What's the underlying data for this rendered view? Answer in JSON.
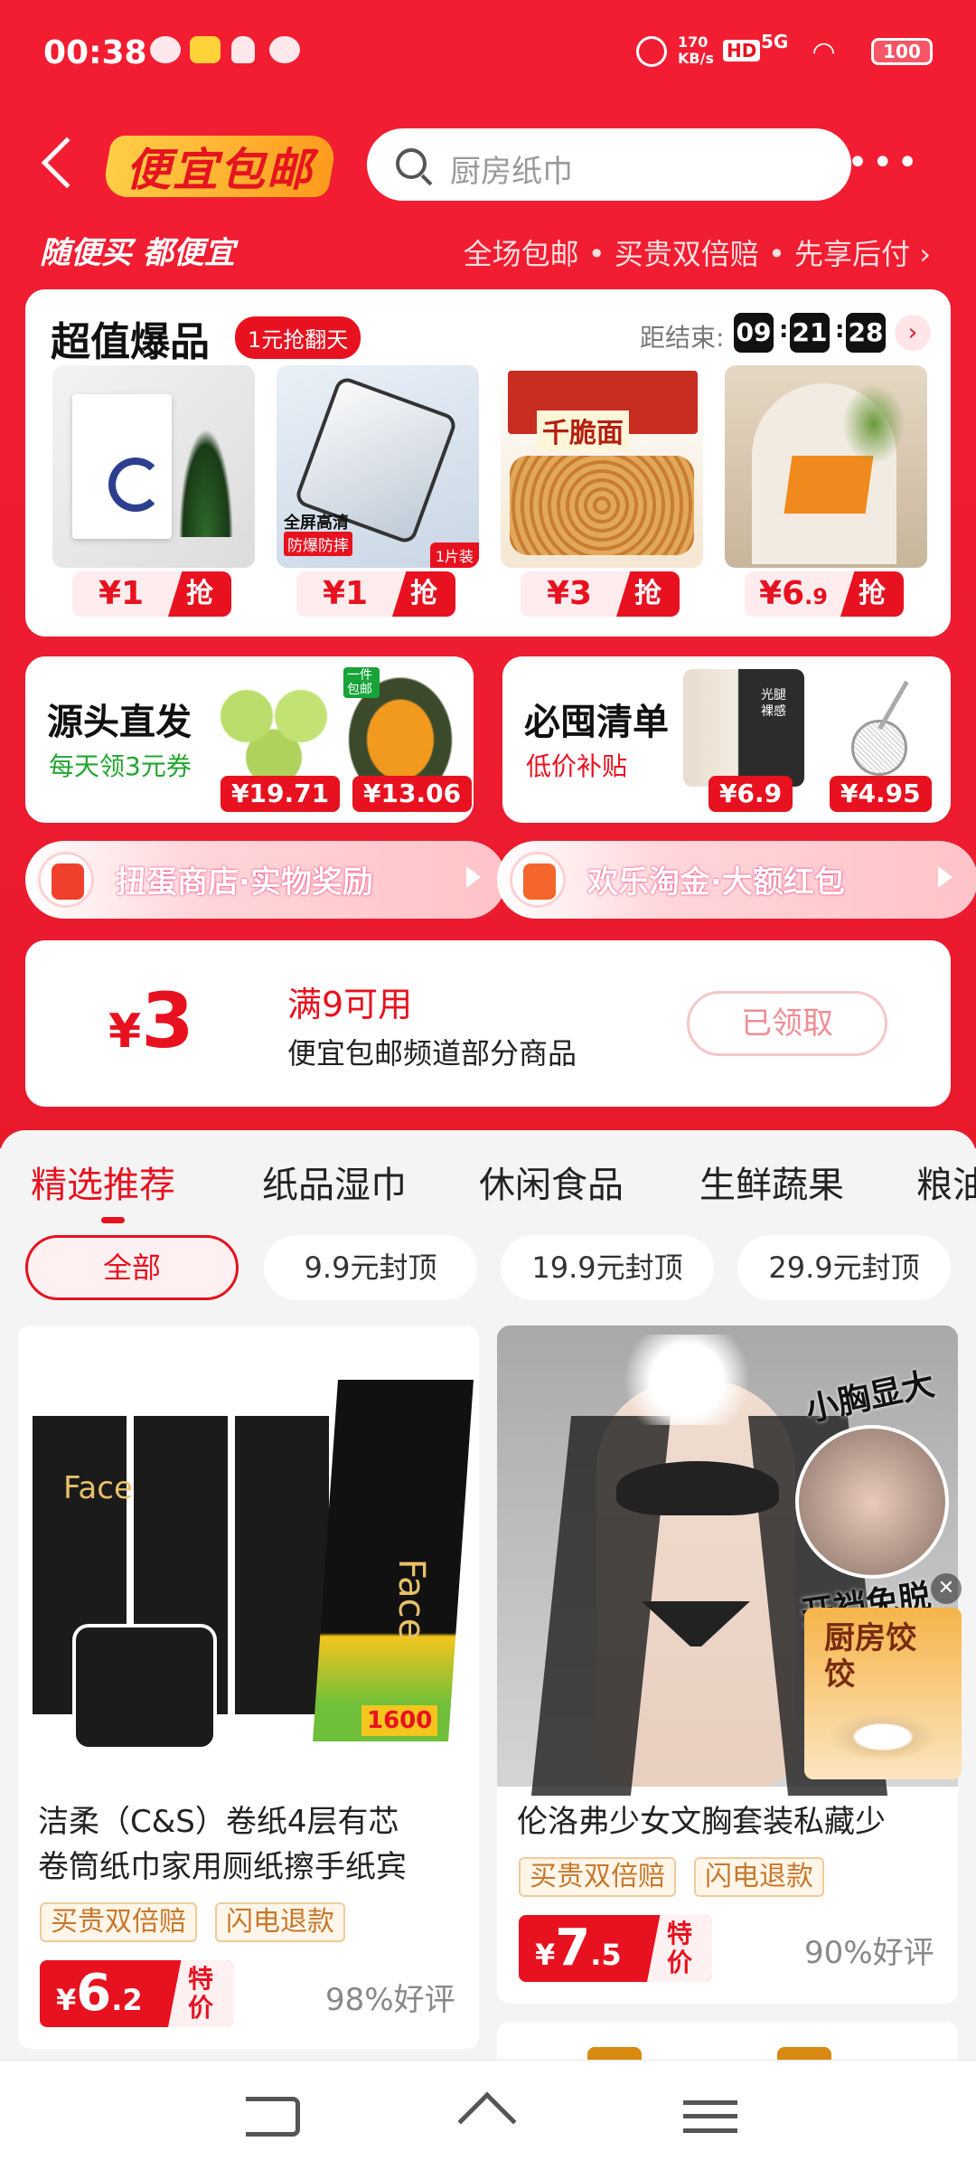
{
  "status_bar": {
    "time": "00:38",
    "net_speed": "170\nKB/s",
    "hd": "HD",
    "signal": "5G",
    "battery": "100"
  },
  "header": {
    "logo": "便宜包邮",
    "search_placeholder": "厨房纸巾",
    "more": "•••"
  },
  "slogan": {
    "left": "随便买 都便宜",
    "right": "全场包邮 • 买贵双倍赔 • 先享后付 ›"
  },
  "hot": {
    "title": "超值爆品",
    "tag": "1元抢翻天",
    "countdown_label": "距结束:",
    "countdown": [
      "09",
      "21",
      "28"
    ],
    "grab": "抢",
    "items": [
      {
        "price_main": "¥1",
        "price_sub": "",
        "img_text": "",
        "badge": ""
      },
      {
        "price_main": "¥1",
        "price_sub": "",
        "img_text": "全屏高清",
        "img_text2": "防爆防摔",
        "badge": "1片装"
      },
      {
        "price_main": "¥3",
        "price_sub": "",
        "img_text": "千脆面",
        "badge": ""
      },
      {
        "price_main": "¥6",
        "price_sub": ".9",
        "img_text": "",
        "badge": ""
      }
    ]
  },
  "sub_left": {
    "title": "源头直发",
    "desc": "每天领3元券",
    "prices": [
      "¥19.71",
      "¥13.06"
    ],
    "mini_tag": "一件包邮"
  },
  "sub_right": {
    "title": "必囤清单",
    "desc": "低价补贴",
    "prices": [
      "¥6.9",
      "¥4.95"
    ],
    "box_text": "光腿 裸感"
  },
  "pills": [
    {
      "label": "扭蛋商店·实物奖励"
    },
    {
      "label": "欢乐淘金·大额红包"
    }
  ],
  "coupon": {
    "amount_sym": "¥",
    "amount": "3",
    "title": "满9可用",
    "desc": "便宜包邮频道部分商品",
    "button": "已领取"
  },
  "tabs": [
    "精选推荐",
    "纸品湿巾",
    "休闲食品",
    "生鲜蔬果",
    "粮油"
  ],
  "filters": [
    "全部",
    "9.9元封顶",
    "19.9元封顶",
    "29.9元封顶"
  ],
  "products": [
    {
      "name_line1": "洁柔（C&S）卷纸4层有芯",
      "name_line2": "卷筒纸巾家用厕纸擦手纸宾",
      "tags": [
        "买贵双倍赔",
        "闪电退款"
      ],
      "price_int": "6",
      "price_dec": ".2",
      "special": "特\n价",
      "rating": "98%好评",
      "img_text": "Face",
      "img_badge": "1600"
    },
    {
      "name_line1": "伦洛弗少女文胸套装私藏少",
      "tags": [
        "买贵双倍赔",
        "闪电退款"
      ],
      "price_int": "7",
      "price_dec": ".5",
      "special": "特\n价",
      "rating": "90%好评",
      "img_text": "小胸显大",
      "img_text2": "开裆免脱"
    }
  ],
  "floating_ad": {
    "text": "厨房饺饺"
  },
  "colors": {
    "primary": "#e8111f",
    "background_red": "#f31d32",
    "tag_border": "#f2c99a"
  }
}
